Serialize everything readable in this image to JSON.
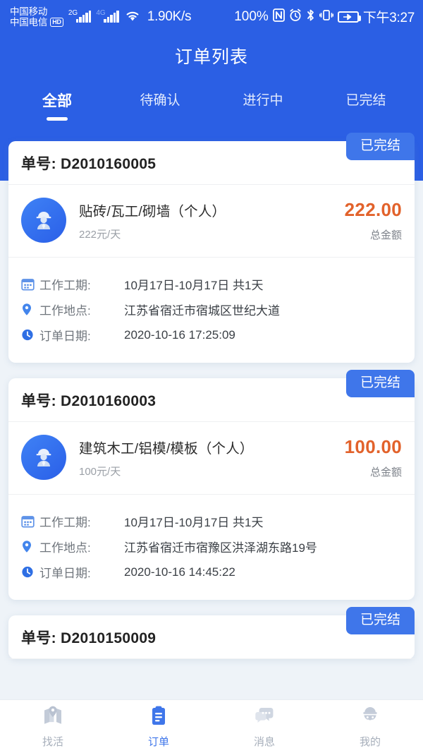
{
  "statusbar": {
    "carrier_line1": "中国移动",
    "carrier_line2": "中国电信",
    "hd_badge": "HD",
    "net_2g": "2G",
    "net_4g": "4G",
    "net_speed": "1.90K/s",
    "nfc_icon": "nfc-icon",
    "alarm_icon": "alarm-icon",
    "bluetooth_icon": "bluetooth-icon",
    "vibrate_icon": "vibrate-icon",
    "battery_percent": "100%",
    "battery_icon": "battery-charging-icon",
    "time": "下午3:27"
  },
  "header": {
    "title": "订单列表",
    "tabs": [
      {
        "label": "全部",
        "active": true
      },
      {
        "label": "待确认",
        "active": false
      },
      {
        "label": "进行中",
        "active": false
      },
      {
        "label": "已完结",
        "active": false
      }
    ]
  },
  "labels": {
    "order_no_prefix": "单号: ",
    "total_amount": "总金额",
    "duration": "工作工期:",
    "location": "工作地点:",
    "order_date": "订单日期:"
  },
  "orders": [
    {
      "order_no": "单号: D2010160005",
      "status": "已完结",
      "job_name": "贴砖/瓦工/砌墙（个人）",
      "rate": "222元/天",
      "price": "222.00",
      "price_label": "总金额",
      "duration_label": "工作工期:",
      "duration_value": "10月17日-10月17日 共1天",
      "location_label": "工作地点:",
      "location_value": "江苏省宿迁市宿城区世纪大道",
      "date_label": "订单日期:",
      "date_value": "2020-10-16 17:25:09"
    },
    {
      "order_no": "单号: D2010160003",
      "status": "已完结",
      "job_name": "建筑木工/铝模/模板（个人）",
      "rate": "100元/天",
      "price": "100.00",
      "price_label": "总金额",
      "duration_label": "工作工期:",
      "duration_value": "10月17日-10月17日 共1天",
      "location_label": "工作地点:",
      "location_value": "江苏省宿迁市宿豫区洪泽湖东路19号",
      "date_label": "订单日期:",
      "date_value": "2020-10-16 14:45:22"
    },
    {
      "order_no": "单号: D2010150009",
      "status": "已完结"
    }
  ],
  "bottomnav": [
    {
      "label": "找活",
      "icon": "map-pin-icon",
      "active": false
    },
    {
      "label": "订单",
      "icon": "clipboard-icon",
      "active": true
    },
    {
      "label": "消息",
      "icon": "chat-bubbles-icon",
      "active": false
    },
    {
      "label": "我的",
      "icon": "helmet-person-icon",
      "active": false
    }
  ],
  "colors": {
    "header_blue": "#2b5fe4",
    "badge_blue": "#3f76ea",
    "price_orange": "#e2622b",
    "page_bg": "#eef3f8",
    "nav_inactive": "#a7afbb"
  }
}
